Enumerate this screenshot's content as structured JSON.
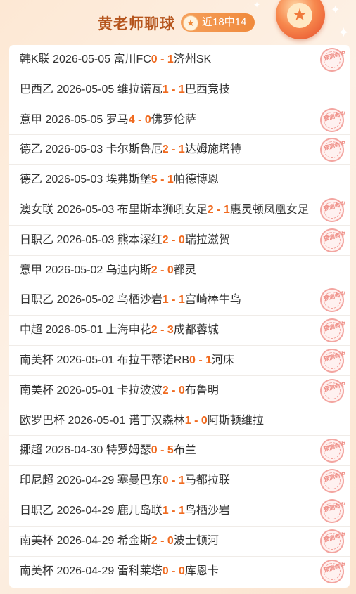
{
  "header": {
    "title": "黄老师聊球",
    "badge_label": "近18中14"
  },
  "stamp_text": "预测命中",
  "rows": [
    {
      "league": "韩K联",
      "date": "2026-05-05",
      "home": "富川FC",
      "hs": "0",
      "as": "1",
      "away": "济州SK",
      "hit": true
    },
    {
      "league": "巴西乙",
      "date": "2026-05-05",
      "home": "维拉诺瓦",
      "hs": "1",
      "as": "1",
      "away": "巴西竞技",
      "hit": false
    },
    {
      "league": "意甲",
      "date": "2026-05-05",
      "home": "罗马",
      "hs": "4",
      "as": "0",
      "away": "佛罗伦萨",
      "hit": true
    },
    {
      "league": "德乙",
      "date": "2026-05-03",
      "home": "卡尔斯鲁厄",
      "hs": "2",
      "as": "1",
      "away": "达姆施塔特",
      "hit": true
    },
    {
      "league": "德乙",
      "date": "2026-05-03",
      "home": "埃弗斯堡",
      "hs": "5",
      "as": "1",
      "away": "帕德博恩",
      "hit": false
    },
    {
      "league": "澳女联",
      "date": "2026-05-03",
      "home": "布里斯本狮吼女足",
      "hs": "2",
      "as": "1",
      "away": "惠灵顿凤凰女足",
      "hit": true
    },
    {
      "league": "日职乙",
      "date": "2026-05-03",
      "home": "熊本深红",
      "hs": "2",
      "as": "0",
      "away": "瑞拉滋贺",
      "hit": true
    },
    {
      "league": "意甲",
      "date": "2026-05-02",
      "home": "乌迪内斯",
      "hs": "2",
      "as": "0",
      "away": "都灵",
      "hit": false
    },
    {
      "league": "日职乙",
      "date": "2026-05-02",
      "home": "鸟栖沙岩",
      "hs": "1",
      "as": "1",
      "away": "宫崎棒牛鸟",
      "hit": true
    },
    {
      "league": "中超",
      "date": "2026-05-01",
      "home": "上海申花",
      "hs": "2",
      "as": "3",
      "away": "成都蓉城",
      "hit": true
    },
    {
      "league": "南美杯",
      "date": "2026-05-01",
      "home": "布拉干蒂诺RB",
      "hs": "0",
      "as": "1",
      "away": "河床",
      "hit": true
    },
    {
      "league": "南美杯",
      "date": "2026-05-01",
      "home": "卡拉波波",
      "hs": "2",
      "as": "0",
      "away": "布鲁明",
      "hit": true
    },
    {
      "league": "欧罗巴杯",
      "date": "2026-05-01",
      "home": "诺丁汉森林",
      "hs": "1",
      "as": "0",
      "away": "阿斯顿维拉",
      "hit": false
    },
    {
      "league": "挪超",
      "date": "2026-04-30",
      "home": "特罗姆瑟",
      "hs": "0",
      "as": "5",
      "away": "布兰",
      "hit": true
    },
    {
      "league": "印尼超",
      "date": "2026-04-29",
      "home": "塞曼巴东",
      "hs": "0",
      "as": "1",
      "away": "马都拉联",
      "hit": true
    },
    {
      "league": "日职乙",
      "date": "2026-04-29",
      "home": "鹿儿岛联",
      "hs": "1",
      "as": "1",
      "away": "鸟栖沙岩",
      "hit": true
    },
    {
      "league": "南美杯",
      "date": "2026-04-29",
      "home": "希金斯",
      "hs": "2",
      "as": "0",
      "away": "波士顿河",
      "hit": true
    },
    {
      "league": "南美杯",
      "date": "2026-04-29",
      "home": "雷科莱塔",
      "hs": "0",
      "as": "0",
      "away": "库恩卡",
      "hit": true
    }
  ]
}
